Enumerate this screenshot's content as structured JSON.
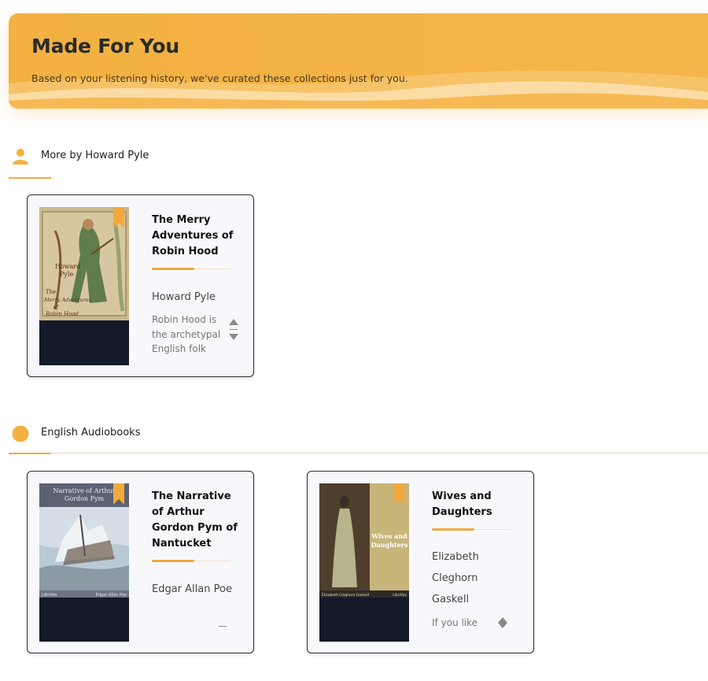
{
  "banner": {
    "title": "Made For You",
    "subtitle": "Based on your listening history, we've curated these collections just for you."
  },
  "colors": {
    "accent": "#f2a93b",
    "banner": "#f2b140",
    "cover_bg": "#141a2a"
  },
  "sections": [
    {
      "label": "More by Howard Pyle",
      "icon": "person-icon",
      "books": [
        {
          "title": "The Merry Adventures of Robin Hood",
          "author": "Howard Pyle",
          "description": "Robin Hood is the archetypal English folk",
          "cover_lines": [
            "Howard",
            "Pyle",
            "The",
            "Merry Adventures",
            "of",
            "Robin Hood"
          ]
        }
      ]
    },
    {
      "label": "English Audiobooks",
      "icon": "circle-icon",
      "books": [
        {
          "title": "The Narrative of Arthur Gordon Pym of Nantucket",
          "author": "Edgar Allan Poe",
          "description": "",
          "cover_lines": [
            "Narrative of Arthur",
            "Gordon Pym",
            "LibriVox",
            "Edgar Allan Poe"
          ]
        },
        {
          "title": "Wives and Daughters",
          "author": "Elizabeth Cleghorn Gaskell",
          "description": "If you like",
          "cover_lines": [
            "Wives and",
            "Daughters",
            "Elizabeth Cleghorn Gaskell",
            "LibriVox"
          ]
        }
      ]
    }
  ]
}
